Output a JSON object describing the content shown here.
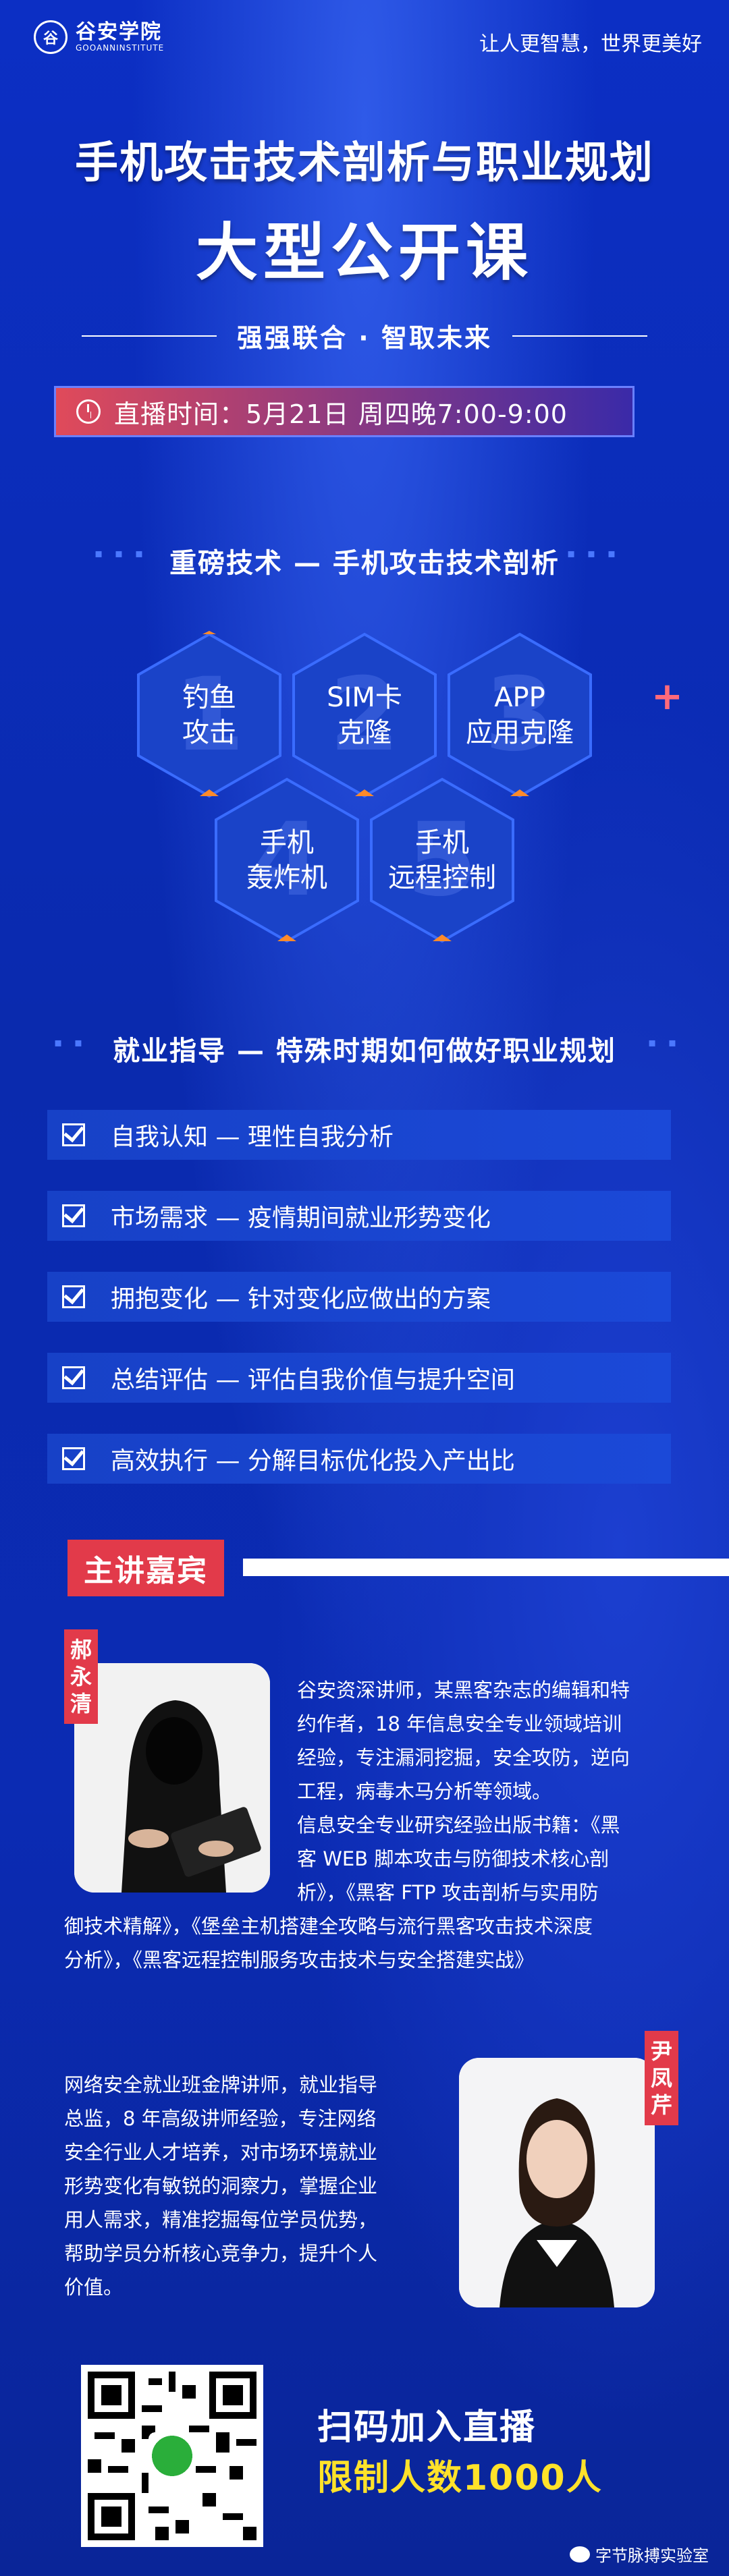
{
  "header": {
    "logo_name": "谷安学院",
    "logo_sub": "GOOANNINSTITUTE",
    "slogan": "让人更智慧，世界更美好"
  },
  "hero": {
    "title": "手机攻击技术剖析与职业规划",
    "subtitle": "大型公开课",
    "tagline": "强强联合 · 智取未来",
    "live_time": "直播时间：5月21日 周四晚7:00-9:00"
  },
  "section1": {
    "title": "重磅技术 — 手机攻击技术剖析",
    "topics": [
      {
        "num": "1",
        "label": "钓鱼\n攻击"
      },
      {
        "num": "2",
        "label": "SIM卡\n克隆"
      },
      {
        "num": "3",
        "label": "APP\n应用克隆"
      },
      {
        "num": "4",
        "label": "手机\n轰炸机"
      },
      {
        "num": "5",
        "label": "手机\n远程控制"
      }
    ]
  },
  "section2": {
    "title": "就业指导 — 特殊时期如何做好职业规划",
    "items": [
      "自我认知 — 理性自我分析",
      "市场需求 — 疫情期间就业形势变化",
      "拥抱变化 — 针对变化应做出的方案",
      "总结评估 — 评估自我价值与提升空间",
      "高效执行 — 分解目标优化投入产出比"
    ]
  },
  "guests": {
    "tag": "主讲嘉宾",
    "speaker1": {
      "name": "郝\n永\n清",
      "bio": [
        "谷安资深讲师，某黑客杂志的编辑和特",
        "约作者，18 年信息安全专业领域培训",
        "经验，专注漏洞挖掘，安全攻防，逆向",
        "工程，病毒木马分析等领域。",
        "信息安全专业研究经验出版书籍：《黑",
        "客 WEB 脚本攻击与防御技术核心剖",
        "析》，《黑客 FTP 攻击剖析与实用防",
        "御技术精解》，《堡垒主机搭建全攻略与流行黑客攻击技术深度",
        "分析》，《黑客远程控制服务攻击技术与安全搭建实战》"
      ]
    },
    "speaker2": {
      "name": "尹\n凤\n芹",
      "bio": [
        "网络安全就业班金牌讲师，就业指导",
        "总监，8 年高级讲师经验，专注网络",
        "安全行业人才培养，对市场环境就业",
        "形势变化有敏锐的洞察力，掌握企业",
        "用人需求，精准挖掘每位学员优势，",
        "帮助学员分析核心竞争力，提升个人",
        "价值。"
      ]
    }
  },
  "cta": {
    "line1": "扫码加入直播",
    "line2": "限制人数1000人"
  },
  "footer": {
    "account": "字节脉搏实验室"
  }
}
